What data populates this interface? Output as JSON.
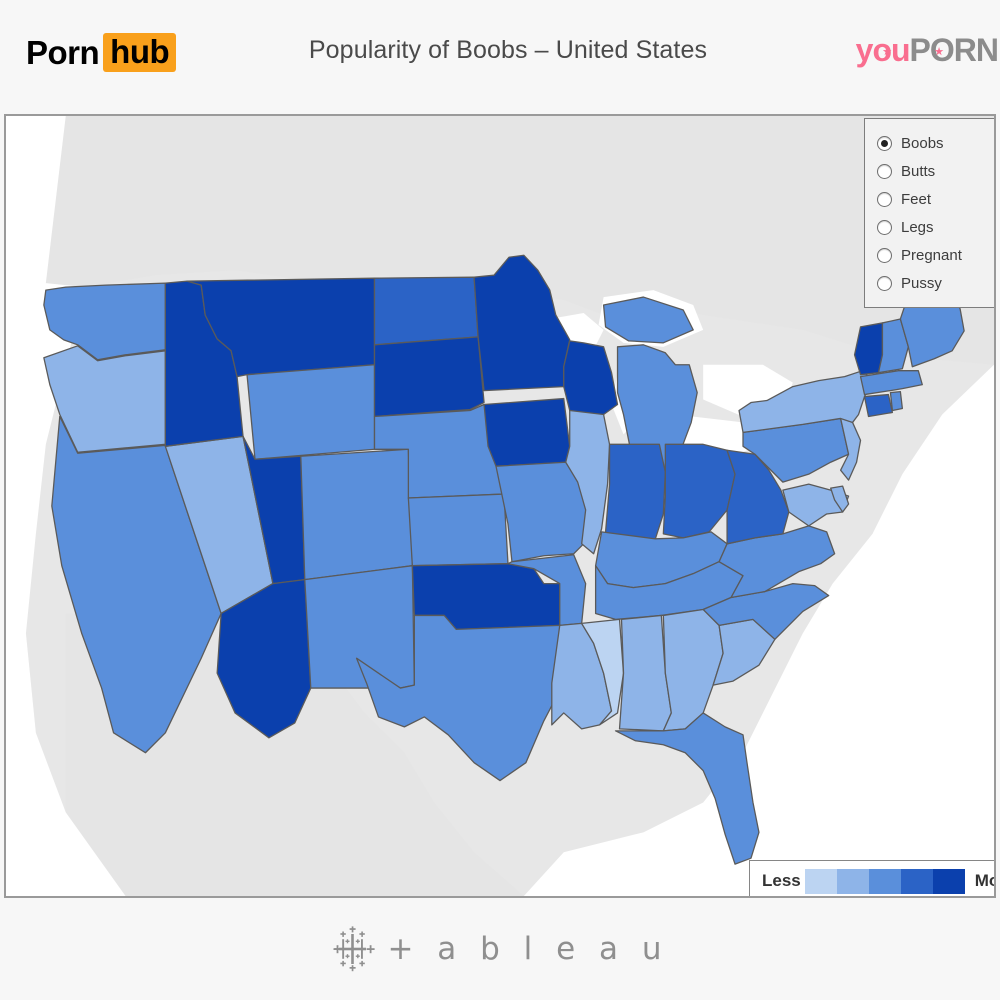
{
  "header": {
    "brand_left": {
      "name": "pornhub-logo",
      "part1": "Porn",
      "part2": "hub",
      "bg": "#f9a01b"
    },
    "title": "Popularity of Boobs – United States",
    "brand_right": {
      "name": "youporn-logo",
      "part1": "you",
      "part2": "PORN",
      "pink": "#f96e8f",
      "gray": "#8c8c8c"
    }
  },
  "filter_panel": {
    "name": "category-radio-group",
    "selected": "Boobs",
    "options": [
      {
        "label": "Boobs",
        "selected": true
      },
      {
        "label": "Butts",
        "selected": false
      },
      {
        "label": "Feet",
        "selected": false
      },
      {
        "label": "Legs",
        "selected": false
      },
      {
        "label": "Pregnant",
        "selected": false
      },
      {
        "label": "Pussy",
        "selected": false
      }
    ]
  },
  "color_legend": {
    "low_label": "Less",
    "high_label": "More",
    "swatches": [
      "#bcd4f2",
      "#8eb4e8",
      "#5a8fdb",
      "#2b63c6",
      "#0b40ad"
    ]
  },
  "footer": {
    "logo_text": "+ a b l e a u",
    "logo_name": "tableau-logo"
  },
  "map": {
    "name": "choropleth-usa",
    "land_other": "#e5e5e5",
    "water": "#ffffff",
    "border": "#5a5a5a",
    "panel_bg": "#e7e7e7"
  },
  "chart_data": {
    "type": "heatmap",
    "title": "Popularity of Boobs – United States",
    "subtitle": "",
    "xlabel": "",
    "ylabel": "",
    "legend_position": "bottom-right",
    "legend_low": "Less",
    "legend_high": "More",
    "scale_colors": [
      "#bcd4f2",
      "#8eb4e8",
      "#5a8fdb",
      "#2b63c6",
      "#0b40ad"
    ],
    "bins": 5,
    "categories_available": [
      "Boobs",
      "Butts",
      "Feet",
      "Legs",
      "Pregnant",
      "Pussy"
    ],
    "active_category": "Boobs",
    "regions": [
      {
        "code": "WA",
        "name": "Washington",
        "bin": 3
      },
      {
        "code": "OR",
        "name": "Oregon",
        "bin": 2
      },
      {
        "code": "CA",
        "name": "California",
        "bin": 3
      },
      {
        "code": "NV",
        "name": "Nevada",
        "bin": 2
      },
      {
        "code": "ID",
        "name": "Idaho",
        "bin": 5
      },
      {
        "code": "MT",
        "name": "Montana",
        "bin": 5
      },
      {
        "code": "WY",
        "name": "Wyoming",
        "bin": 3
      },
      {
        "code": "UT",
        "name": "Utah",
        "bin": 5
      },
      {
        "code": "AZ",
        "name": "Arizona",
        "bin": 5
      },
      {
        "code": "CO",
        "name": "Colorado",
        "bin": 3
      },
      {
        "code": "NM",
        "name": "New Mexico",
        "bin": 3
      },
      {
        "code": "ND",
        "name": "North Dakota",
        "bin": 4
      },
      {
        "code": "SD",
        "name": "South Dakota",
        "bin": 5
      },
      {
        "code": "NE",
        "name": "Nebraska",
        "bin": 3
      },
      {
        "code": "KS",
        "name": "Kansas",
        "bin": 3
      },
      {
        "code": "OK",
        "name": "Oklahoma",
        "bin": 5
      },
      {
        "code": "TX",
        "name": "Texas",
        "bin": 3
      },
      {
        "code": "MN",
        "name": "Minnesota",
        "bin": 5
      },
      {
        "code": "IA",
        "name": "Iowa",
        "bin": 5
      },
      {
        "code": "MO",
        "name": "Missouri",
        "bin": 3
      },
      {
        "code": "AR",
        "name": "Arkansas",
        "bin": 3
      },
      {
        "code": "LA",
        "name": "Louisiana",
        "bin": 2
      },
      {
        "code": "WI",
        "name": "Wisconsin",
        "bin": 5
      },
      {
        "code": "IL",
        "name": "Illinois",
        "bin": 2
      },
      {
        "code": "MI",
        "name": "Michigan",
        "bin": 3
      },
      {
        "code": "IN",
        "name": "Indiana",
        "bin": 4
      },
      {
        "code": "OH",
        "name": "Ohio",
        "bin": 4
      },
      {
        "code": "KY",
        "name": "Kentucky",
        "bin": 3
      },
      {
        "code": "TN",
        "name": "Tennessee",
        "bin": 3
      },
      {
        "code": "MS",
        "name": "Mississippi",
        "bin": 1
      },
      {
        "code": "AL",
        "name": "Alabama",
        "bin": 2
      },
      {
        "code": "GA",
        "name": "Georgia",
        "bin": 2
      },
      {
        "code": "FL",
        "name": "Florida",
        "bin": 3
      },
      {
        "code": "SC",
        "name": "South Carolina",
        "bin": 2
      },
      {
        "code": "NC",
        "name": "North Carolina",
        "bin": 3
      },
      {
        "code": "VA",
        "name": "Virginia",
        "bin": 3
      },
      {
        "code": "WV",
        "name": "West Virginia",
        "bin": 4
      },
      {
        "code": "MD",
        "name": "Maryland",
        "bin": 2
      },
      {
        "code": "DE",
        "name": "Delaware",
        "bin": 2
      },
      {
        "code": "PA",
        "name": "Pennsylvania",
        "bin": 3
      },
      {
        "code": "NJ",
        "name": "New Jersey",
        "bin": 2
      },
      {
        "code": "NY",
        "name": "New York",
        "bin": 2
      },
      {
        "code": "CT",
        "name": "Connecticut",
        "bin": 4
      },
      {
        "code": "RI",
        "name": "Rhode Island",
        "bin": 3
      },
      {
        "code": "MA",
        "name": "Massachusetts",
        "bin": 3
      },
      {
        "code": "VT",
        "name": "Vermont",
        "bin": 5
      },
      {
        "code": "NH",
        "name": "New Hampshire",
        "bin": 3
      },
      {
        "code": "ME",
        "name": "Maine",
        "bin": 3
      }
    ]
  }
}
